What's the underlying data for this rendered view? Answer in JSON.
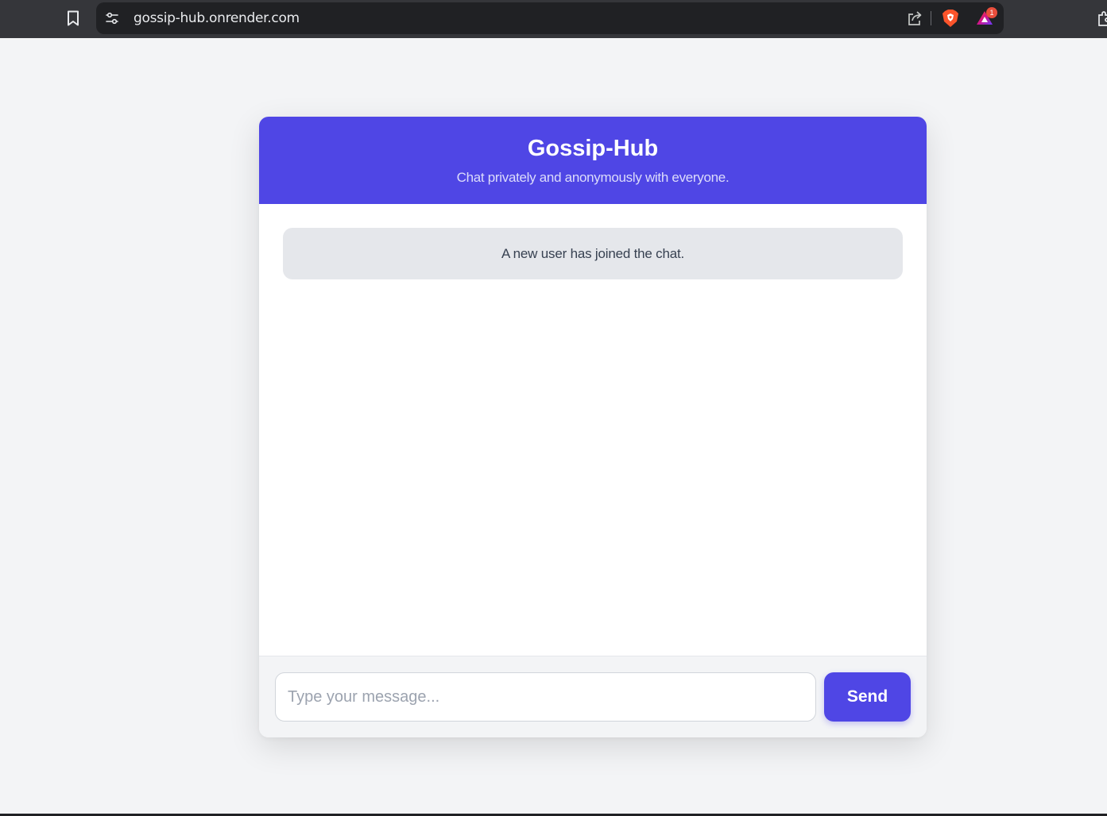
{
  "browser": {
    "url": "gossip-hub.onrender.com",
    "rewards_badge_count": "1",
    "icons": [
      "bookmark-icon",
      "site-settings-icon",
      "share-icon",
      "brave-shields-icon",
      "brave-rewards-icon",
      "extensions-icon"
    ]
  },
  "header": {
    "title": "Gossip-Hub",
    "subtitle": "Chat privately and anonymously with everyone."
  },
  "messages": [
    {
      "type": "system",
      "text": "A new user has joined the chat."
    }
  ],
  "composer": {
    "placeholder": "Type your message...",
    "value": "",
    "send_label": "Send"
  },
  "colors": {
    "accent": "#4f46e5",
    "page_background": "#f3f4f6",
    "system_message_bg": "#e5e7eb"
  }
}
